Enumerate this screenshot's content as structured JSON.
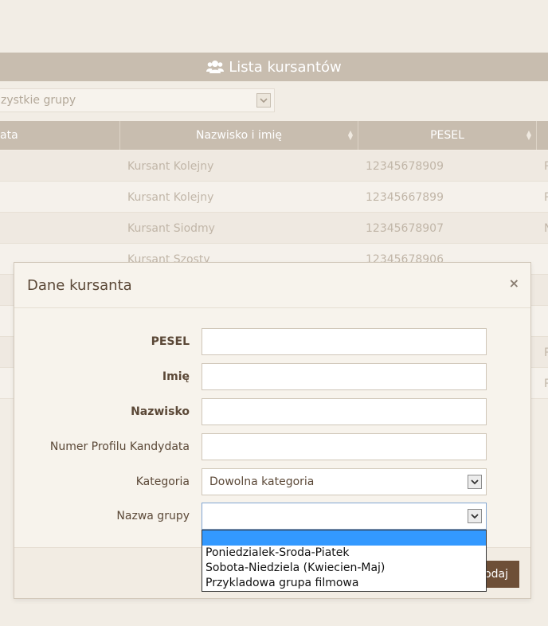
{
  "panel": {
    "title": "Lista kursantów",
    "icon": "users-icon"
  },
  "filter": {
    "selected": "zystkie grupy"
  },
  "table": {
    "columns": [
      "ata",
      "Nazwisko i imię",
      "PESEL",
      ""
    ],
    "rows": [
      {
        "name": "Kursant Kolejny",
        "pesel": "12345678909",
        "extra": "P"
      },
      {
        "name": "Kursant Kolejny",
        "pesel": "12345667899",
        "extra": "P"
      },
      {
        "name": "Kursant Siodmy",
        "pesel": "12345678907",
        "extra": "N"
      },
      {
        "name": "Kursant Szosty",
        "pesel": "12345678906",
        "extra": ""
      },
      {
        "name": "",
        "pesel": "",
        "extra": ""
      },
      {
        "name": "",
        "pesel": "",
        "extra": ""
      },
      {
        "name": "",
        "pesel": "",
        "extra": "P"
      },
      {
        "name": "",
        "pesel": "",
        "extra": "P"
      }
    ]
  },
  "modal": {
    "title": "Dane kursanta",
    "close": "×",
    "fields": {
      "pesel": {
        "label": "PESEL",
        "value": ""
      },
      "imie": {
        "label": "Imię",
        "value": ""
      },
      "nazwisko": {
        "label": "Nazwisko",
        "value": ""
      },
      "numer_profilu": {
        "label": "Numer Profilu Kandydata",
        "value": ""
      },
      "kategoria": {
        "label": "Kategoria",
        "value": "Dowolna kategoria"
      },
      "nazwa_grupy": {
        "label": "Nazwa grupy",
        "value": ""
      }
    },
    "group_options": [
      "",
      "Poniedzialek-Sroda-Piatek",
      "Sobota-Niedziela (Kwiecien-Maj)",
      "Przykladowa grupa filmowa"
    ],
    "save_label": "odaj"
  }
}
